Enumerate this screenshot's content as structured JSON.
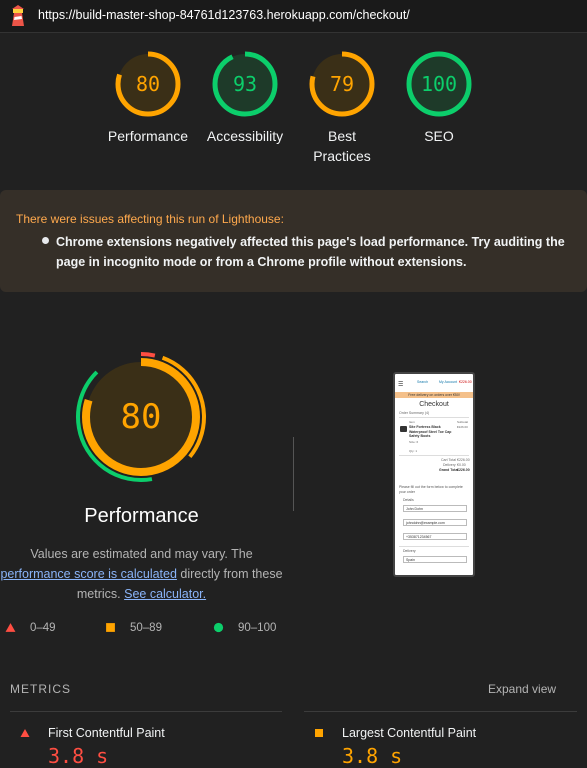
{
  "topbar": {
    "url": "https://build-master-shop-84761d123763.herokuapp.com/checkout/"
  },
  "categories": [
    {
      "label": "Performance",
      "score": "80",
      "color": "#ffa400",
      "fill": 0.8
    },
    {
      "label": "Accessibility",
      "score": "93",
      "color": "#0cce6b",
      "fill": 0.93
    },
    {
      "label": "Best Practices",
      "score": "79",
      "color": "#ffa400",
      "fill": 0.79
    },
    {
      "label": "SEO",
      "score": "100",
      "color": "#0cce6b",
      "fill": 1.0
    }
  ],
  "warning": {
    "title": "There were issues affecting this run of Lighthouse:",
    "item": "Chrome extensions negatively affected this page's load performance. Try auditing the page in incognito mode or from a Chrome profile without extensions."
  },
  "performance": {
    "score": "80",
    "title": "Performance",
    "desc_pre": "Values are estimated and may vary. The ",
    "desc_link": "performance score is calculated",
    "desc_mid": " directly from these metrics. ",
    "desc_link2": "See calculator."
  },
  "legend": [
    {
      "label": "0–49",
      "color": "#ff4e42",
      "shape": "triangle"
    },
    {
      "label": "50–89",
      "color": "#ffa400",
      "shape": "square"
    },
    {
      "label": "90–100",
      "color": "#0cce6b",
      "shape": "circle"
    }
  ],
  "metrics": {
    "heading": "METRICS",
    "expand": "Expand view",
    "items": [
      {
        "name": "First Contentful Paint",
        "value": "3.8 s",
        "color": "#ff4e42",
        "shape": "triangle"
      },
      {
        "name": "Largest Contentful Paint",
        "value": "3.8 s",
        "color": "#ffa400",
        "shape": "square"
      }
    ]
  },
  "thumbnail": {
    "nav_search": "Search",
    "nav_account": "My Account",
    "nav_cart": "€226.00",
    "banner": "Free delivery on orders over €50!",
    "title": "Checkout",
    "summary": "Order Summary (4)",
    "item_label": "Item",
    "item_name": "Site Fortress Black Waterproof Steel Toe Cap Safety Boots",
    "item_size": "Size: 6",
    "item_qty": "Qty: 1",
    "subtotal_label": "Subtotal",
    "cart_total": "Cart Total",
    "delivery": "Delivery",
    "grand_total": "Grand Total",
    "cart_total_val": "€226.00",
    "delivery_val": "€0.00",
    "grand_total_val": "€226.00",
    "form_intro": "Please fill out the form below to complete your order",
    "details": "Details",
    "name_val": "John Dohn",
    "email_val": "johndohn@example.com",
    "phone_val": "+353871234567",
    "delivery_heading": "Delivery",
    "country_val": "Spain"
  }
}
